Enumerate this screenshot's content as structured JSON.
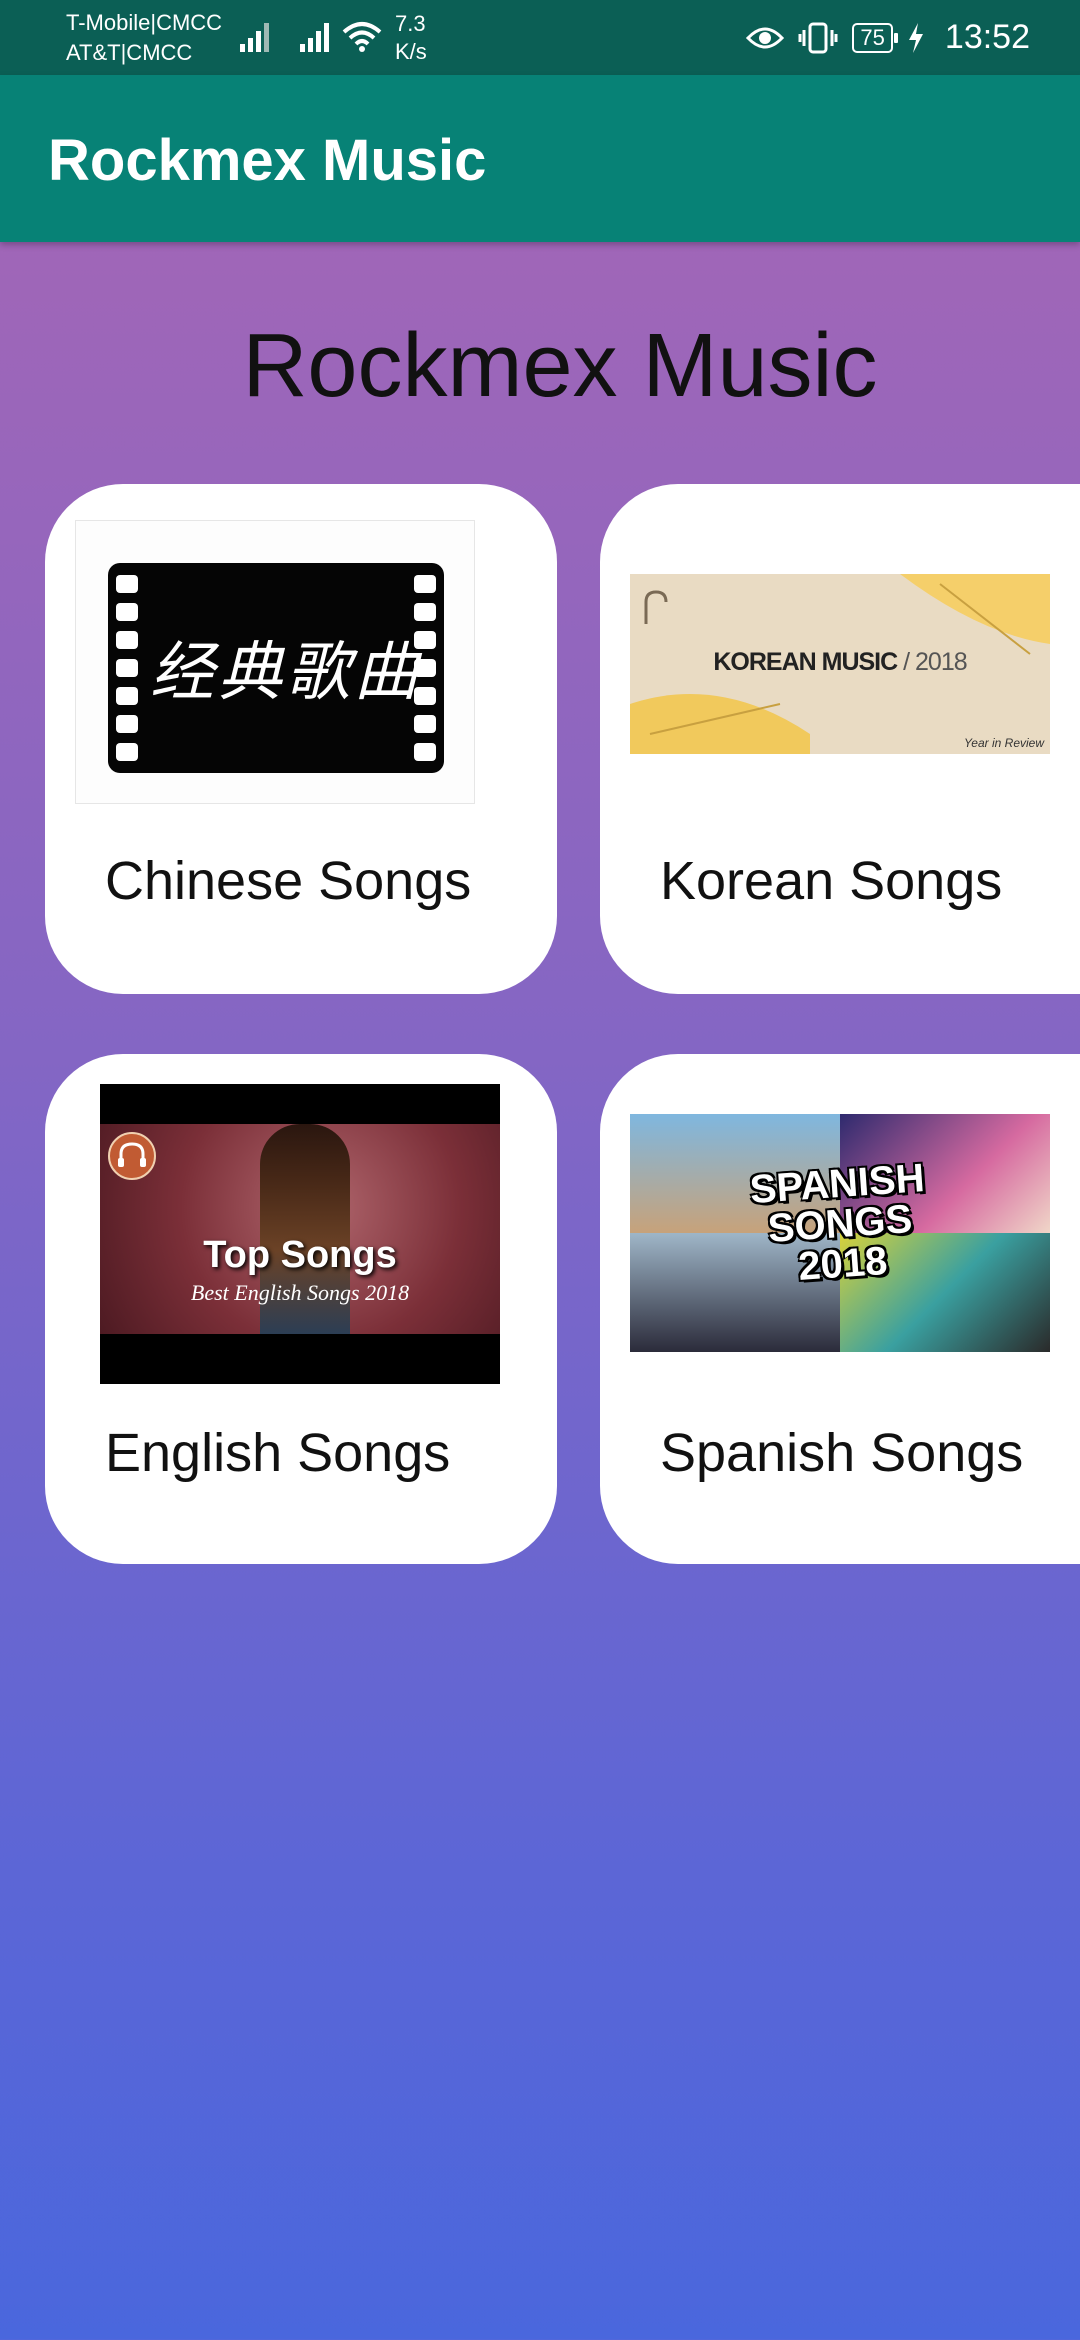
{
  "status_bar": {
    "carrier_line1": "T-Mobile|CMCC",
    "carrier_line2": "AT&T|CMCC",
    "net_speed_value": "7.3",
    "net_speed_unit": "K/s",
    "battery": "75",
    "time": "13:52"
  },
  "app_bar": {
    "title": "Rockmex Music"
  },
  "page": {
    "heading": "Rockmex Music"
  },
  "categories": [
    {
      "label": "Chinese Songs",
      "thumb_text": "经典歌曲"
    },
    {
      "label": "Korean Songs",
      "thumb_text": "KOREAN MUSIC",
      "thumb_year": "/ 2018",
      "thumb_note": "Year in Review"
    },
    {
      "label": "English Songs",
      "thumb_title": "Top Songs",
      "thumb_subtitle": "Best English Songs 2018"
    },
    {
      "label": "Spanish Songs",
      "thumb_text_1": "SPANISH",
      "thumb_text_2": "SONGS",
      "thumb_text_3": "2018"
    }
  ],
  "colors": {
    "status_bar": "#0b5f55",
    "app_bar": "#078276",
    "gradient_top": "#a866b4",
    "gradient_bottom": "#4a67dd"
  }
}
